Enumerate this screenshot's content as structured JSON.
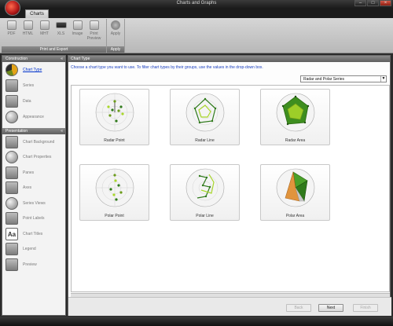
{
  "window": {
    "title": "Charts and Graphs"
  },
  "ribbon": {
    "tab_label": "Charts",
    "groups": [
      {
        "label": "Print and Export",
        "items": [
          "PDF",
          "HTML",
          "MHT",
          "XLS",
          "Image",
          "Print Preview"
        ]
      },
      {
        "label": "Apply",
        "items": [
          "Apply"
        ]
      }
    ]
  },
  "sidebar": {
    "construction_label": "Construction",
    "construction_items": [
      "Chart Type",
      "Series",
      "Data",
      "Appearance"
    ],
    "presentation_label": "Presentation",
    "presentation_items": [
      "Chart Background",
      "Chart Properties",
      "Panes",
      "Axes",
      "Series Views",
      "Point Labels",
      "Chart Titles",
      "Legend",
      "Preview"
    ],
    "chevron": "«"
  },
  "main": {
    "header": "Chart Type",
    "instruction": "Choose a chart type you want to use. To filter chart types by their groups, use the values in the drop-down box.",
    "filter_value": "Radar and Polar Series",
    "chart_types": [
      "Radar Point",
      "Radar Line",
      "Radar Area",
      "Polar Point",
      "Polar Line",
      "Polar Area"
    ]
  },
  "footer": {
    "back_label": "Back",
    "next_label": "Next",
    "finish_label": "Finish"
  },
  "colors": {
    "accent_green": "#4a9a2a",
    "lime": "#a8d62a",
    "orange": "#e08a2a"
  },
  "icons": {
    "dropdown_arrow": "▼"
  }
}
